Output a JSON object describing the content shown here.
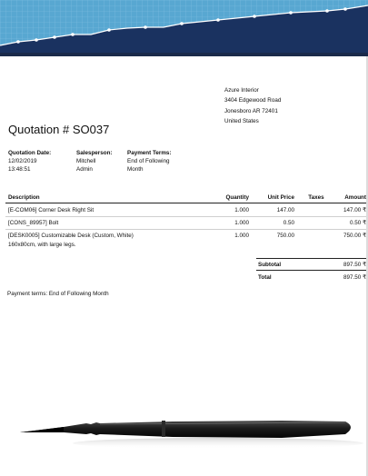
{
  "colors": {
    "banner_dark": "#1a3260",
    "banner_light": "#58a7d1",
    "grid_line": "#7fc0e2"
  },
  "address": {
    "lines": [
      "Azure Interior",
      "3404 Edgewood Road",
      "Jonesboro AR 72401",
      "United States"
    ]
  },
  "title": "Quotation # SO037",
  "info": {
    "date_label": "Quotation Date:",
    "date_value": "12/02/2019",
    "time_value": "13:48:51",
    "salesperson_label": "Salesperson:",
    "salesperson_line1": "Mitchell",
    "salesperson_line2": "Admin",
    "terms_label": "Payment Terms:",
    "terms_line1": "End of Following",
    "terms_line2": "Month"
  },
  "table": {
    "headers": {
      "description": "Description",
      "quantity": "Quantity",
      "unit_price": "Unit Price",
      "taxes": "Taxes",
      "amount": "Amount"
    },
    "rows": [
      {
        "desc1": "[E-COM06] Corner Desk Right Sit",
        "desc2": "",
        "qty": "1.000",
        "price": "147.00",
        "taxes": "",
        "amount": "147.00 ₹"
      },
      {
        "desc1": "[CONS_89957] Bolt",
        "desc2": "",
        "qty": "1.000",
        "price": "0.50",
        "taxes": "",
        "amount": "0.50 ₹"
      },
      {
        "desc1": "[DESK0005] Customizable Desk (Custom, White)",
        "desc2": "160x80cm, with large legs.",
        "qty": "1.000",
        "price": "750.00",
        "taxes": "",
        "amount": "750.00 ₹"
      }
    ]
  },
  "totals": {
    "subtotal_label": "Subtotal",
    "subtotal_value": "897.50 ₹",
    "total_label": "Total",
    "total_value": "897.50 ₹"
  },
  "payment_note": "Payment terms: End of Following Month"
}
